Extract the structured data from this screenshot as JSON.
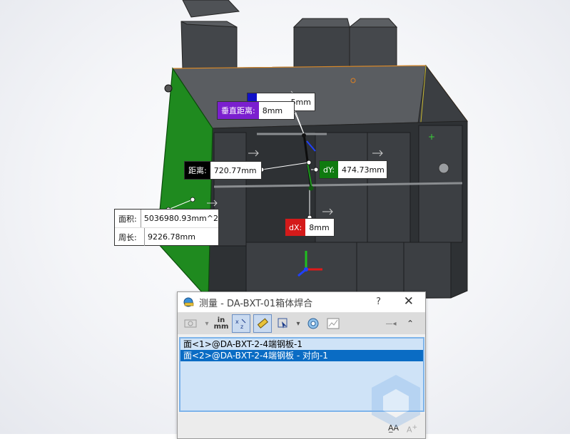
{
  "app": {
    "dialog_title": "测量 - DA-BXT-01箱体焊合",
    "help_label": "?",
    "close_label": "✕"
  },
  "colors": {
    "selected_face": "#1f8a1f",
    "vertical_tag": "#7b1fcf",
    "distance_tag": "#000000",
    "dy_tag": "#0f7a0f",
    "dx_tag": "#d41a1a",
    "hidden_tag": "#1010c8",
    "list_selection": "#0a6cc4",
    "list_background": "#cfe3f7"
  },
  "callouts": {
    "vertical": {
      "label": "垂直距离:",
      "value": "8mm"
    },
    "hidden_value": "5mm",
    "distance": {
      "label": "距离:",
      "value": "720.77mm"
    },
    "dy": {
      "label": "dY:",
      "value": "474.73mm"
    },
    "dx": {
      "label": "dX:",
      "value": "8mm"
    },
    "area": {
      "label": "面积:",
      "value": "5036980.93mm^2"
    },
    "perimeter": {
      "label": "周长:",
      "value": "9226.78mm"
    }
  },
  "toolbar": {
    "units_label": "in\nmm",
    "items": [
      "arc-circle-icon",
      "units-icon",
      "xyz-delta-icon",
      "point-to-point-icon",
      "select-cursor-icon",
      "projection-icon",
      "history-icon",
      "pin-icon",
      "collapse-icon"
    ]
  },
  "selection_list": [
    {
      "label": "面<1>@DA-BXT-2-4端钢板-1",
      "selected": false
    },
    {
      "label": "面<2>@DA-BXT-2-4端钢板 - 对向-1",
      "selected": true
    }
  ],
  "footer": {
    "icons": [
      "text-size-increase-icon",
      "text-size-decrease-icon"
    ]
  }
}
